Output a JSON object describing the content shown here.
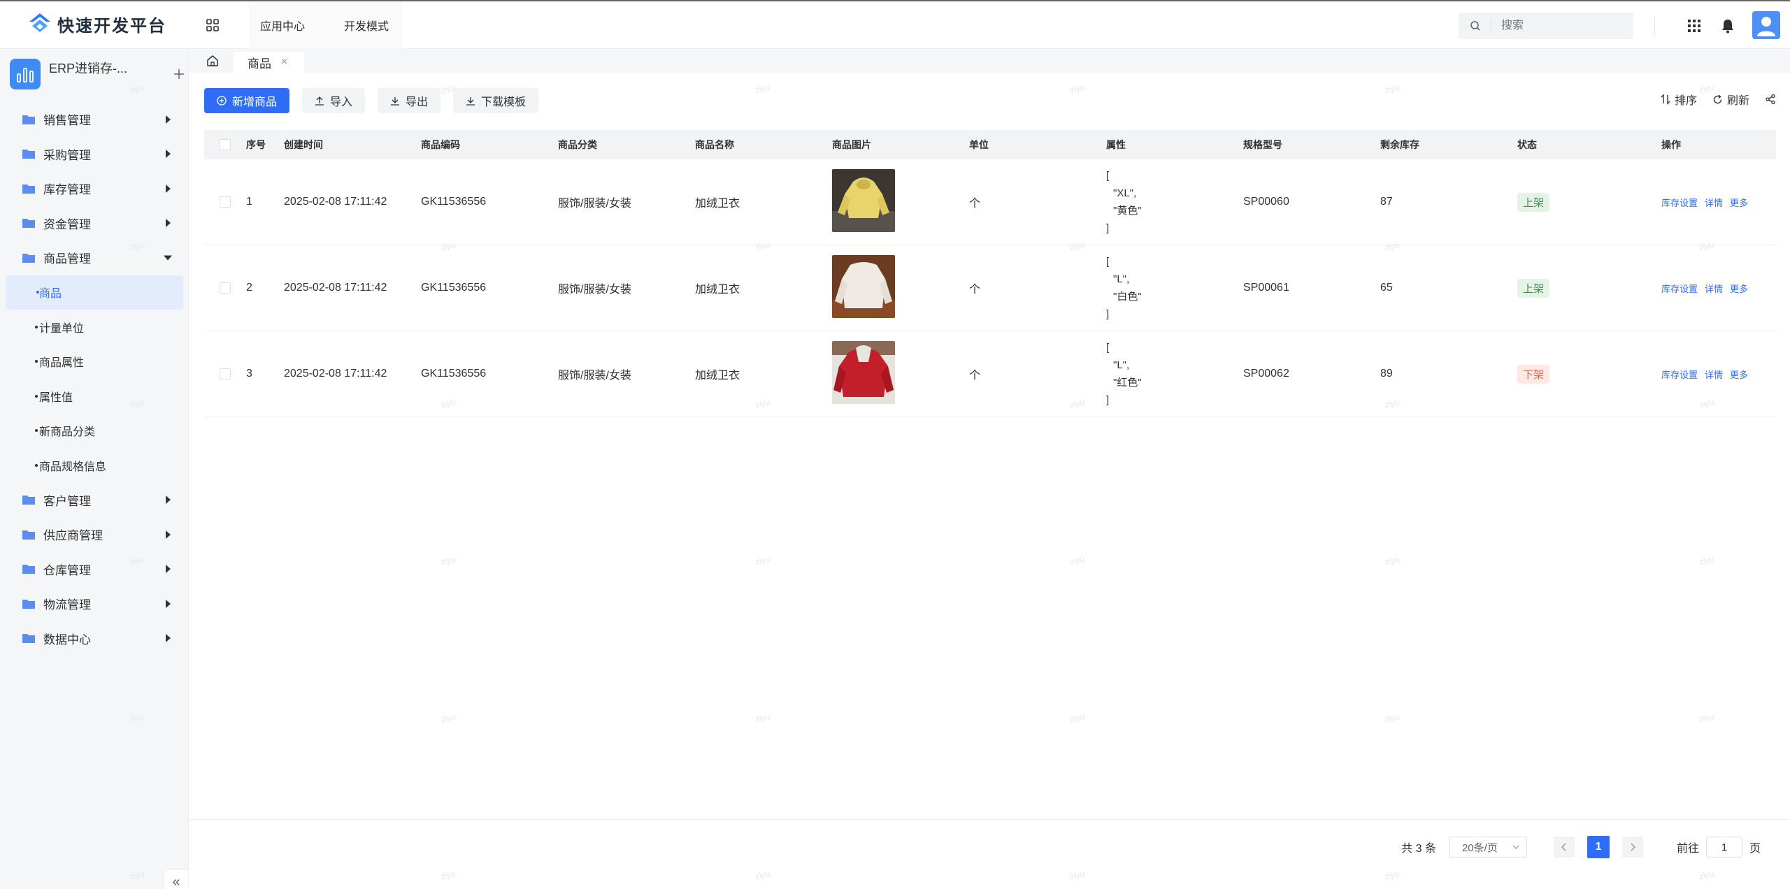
{
  "header": {
    "logo_text": "快速开发平台",
    "nav": [
      "应用中心",
      "开发模式"
    ],
    "search_placeholder": "搜索"
  },
  "sidebar": {
    "app_name": "ERP进销存-...",
    "menu": [
      {
        "label": "销售管理"
      },
      {
        "label": "采购管理"
      },
      {
        "label": "库存管理"
      },
      {
        "label": "资金管理"
      },
      {
        "label": "商品管理",
        "expanded": true,
        "children": [
          "商品",
          "计量单位",
          "商品属性",
          "属性值",
          "新商品分类",
          "商品规格信息"
        ]
      },
      {
        "label": "客户管理"
      },
      {
        "label": "供应商管理"
      },
      {
        "label": "仓库管理"
      },
      {
        "label": "物流管理"
      },
      {
        "label": "数据中心"
      }
    ]
  },
  "tabs": {
    "active": "商品",
    "close": "×"
  },
  "toolbar": {
    "add": "新增商品",
    "import": "导入",
    "export": "导出",
    "template": "下载模板",
    "sort": "排序",
    "refresh": "刷新"
  },
  "table": {
    "columns": [
      "序号",
      "创建时间",
      "商品编码",
      "商品分类",
      "商品名称",
      "商品图片",
      "单位",
      "属性",
      "规格型号",
      "剩余库存",
      "状态",
      "操作"
    ],
    "rows": [
      {
        "no": "1",
        "time": "2025-02-08 17:11:42",
        "code": "GK11536556",
        "category": "服饰/服装/女装",
        "name": "加绒卫衣",
        "image": "yellow-hoodie",
        "unit": "个",
        "attr": [
          "[",
          "\"XL\",",
          "\"黄色\"",
          "]"
        ],
        "spec": "SP00060",
        "stock": "87",
        "status": "上架",
        "status_type": "on"
      },
      {
        "no": "2",
        "time": "2025-02-08 17:11:42",
        "code": "GK11536556",
        "category": "服饰/服装/女装",
        "name": "加绒卫衣",
        "image": "white-hoodie",
        "unit": "个",
        "attr": [
          "[",
          "\"L\",",
          "\"白色\"",
          "]"
        ],
        "spec": "SP00061",
        "stock": "65",
        "status": "上架",
        "status_type": "on"
      },
      {
        "no": "3",
        "time": "2025-02-08 17:11:42",
        "code": "GK11536556",
        "category": "服饰/服装/女装",
        "name": "加绒卫衣",
        "image": "red-hoodie",
        "unit": "个",
        "attr": [
          "[",
          "\"L\",",
          "\"红色\"",
          "]"
        ],
        "spec": "SP00062",
        "stock": "89",
        "status": "下架",
        "status_type": "off"
      }
    ],
    "ops": [
      "库存设置",
      "详情",
      "更多"
    ]
  },
  "pager": {
    "total": "共 3 条",
    "size": "20条/页",
    "current": "1",
    "goto_label": "前往",
    "goto_value": "1",
    "page_suffix": "页"
  },
  "watermark": "ziyu",
  "colors": {
    "primary": "#2f6df6",
    "on": "#4a8a54",
    "off": "#e06c55"
  }
}
